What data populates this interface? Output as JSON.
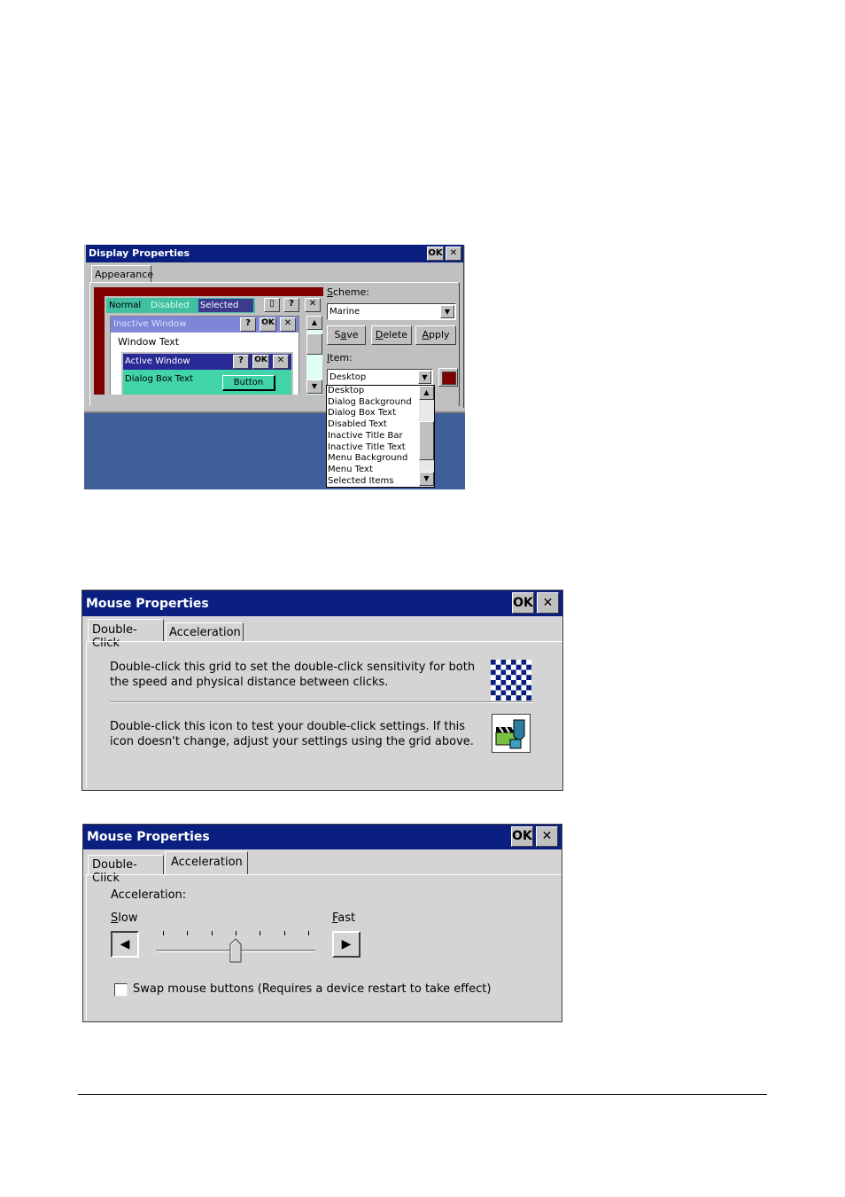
{
  "display": {
    "title": "Display Properties",
    "ok": "OK",
    "close": "✕",
    "tab": "Appearance",
    "preview": {
      "normal": "Normal",
      "disabled": "Disabled",
      "selected": "Selected",
      "inactive_title": "Inactive Window",
      "window_text": "Window Text",
      "active_title": "Active Window",
      "dialog_text": "Dialog Box Text",
      "button": "Button",
      "q": "?",
      "ok": "OK",
      "x": "✕"
    },
    "scheme_label": "Scheme:",
    "scheme_value": "Marine",
    "save": "Save",
    "delete": "Delete",
    "apply": "Apply",
    "item_label": "Item:",
    "item_value": "Desktop",
    "item_color": "#800000",
    "list": [
      "Desktop",
      "Dialog Background",
      "Dialog Box Text",
      "Disabled Text",
      "Inactive Title Bar",
      "Inactive Title Text",
      "Menu Background",
      "Menu Text",
      "Selected Items"
    ]
  },
  "mouse1": {
    "title": "Mouse Properties",
    "ok": "OK",
    "close": "✕",
    "tabs": [
      "Double-Click",
      "Acceleration"
    ],
    "text1a": "Double-click this grid to set the double-click sensitivity for both",
    "text1b": "the speed and physical distance between clicks.",
    "text2a": "Double-click this icon to test your double-click settings. If this",
    "text2b": "icon doesn't change, adjust your settings using the grid above."
  },
  "mouse2": {
    "title": "Mouse Properties",
    "ok": "OK",
    "close": "✕",
    "tabs": [
      "Double-Click",
      "Acceleration"
    ],
    "accel_label": "Acceleration:",
    "slow": "Slow",
    "fast": "Fast",
    "slider_level": 0.5,
    "swap_label": "Swap mouse buttons (Requires a device restart to take effect)",
    "swap_checked": false
  }
}
